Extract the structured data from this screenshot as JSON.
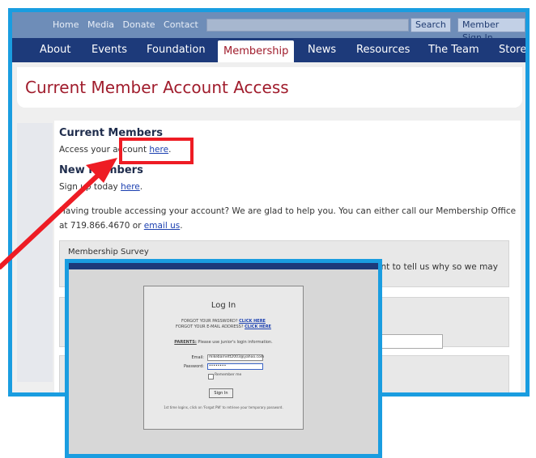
{
  "topbar": {
    "links": [
      "Home",
      "Media",
      "Donate",
      "Contact"
    ],
    "search_button": "Search",
    "member_signin_button": "Member Sign In"
  },
  "nav": {
    "items": [
      "About",
      "Events",
      "Foundation",
      "Membership",
      "News",
      "Resources",
      "The Team",
      "Store"
    ],
    "active": "Membership"
  },
  "page": {
    "title": "Current Member Account Access",
    "current_members_heading": "Current Members",
    "access_text": "Access your account ",
    "access_link": "here",
    "access_suffix": ".",
    "new_members_heading": "New Members",
    "signup_text": "Sign up today ",
    "signup_link": "here",
    "signup_suffix": ".",
    "trouble_text": "Having trouble accessing your account?  We are glad to help you.  You can either call our Membership Office",
    "phone_text": "at 719.866.4670 or ",
    "email_link": "email us",
    "email_suffix": ".",
    "survey_label": "Membership Survey",
    "survey_tail": "ent to tell us why so we may"
  },
  "login": {
    "title": "Log In",
    "forgot_password_text": "FORGOT YOUR PASSWORD? ",
    "forgot_password_link": "CLICK HERE",
    "forgot_email_text": "FORGOT YOUR E-MAIL ADDRESS? ",
    "forgot_email_link": "CLICK HERE",
    "parents_label": "PARENTS:",
    "parents_text": " Please use junior's login information.",
    "email_label": "Email:",
    "email_value": "mikebarnett2003@yahoo.com",
    "password_label": "Password:",
    "password_value": "••••••••",
    "remember_label": "Remember me",
    "signin_button": "Sign In",
    "footer_note": "1st time logins, click on 'Forgot PW' to retrieve your temporary password."
  },
  "colors": {
    "frame_border": "#1a9de0",
    "nav_bg": "#1d3a7a",
    "title_color": "#a01c2c",
    "annotation_red": "#ee1c24"
  }
}
